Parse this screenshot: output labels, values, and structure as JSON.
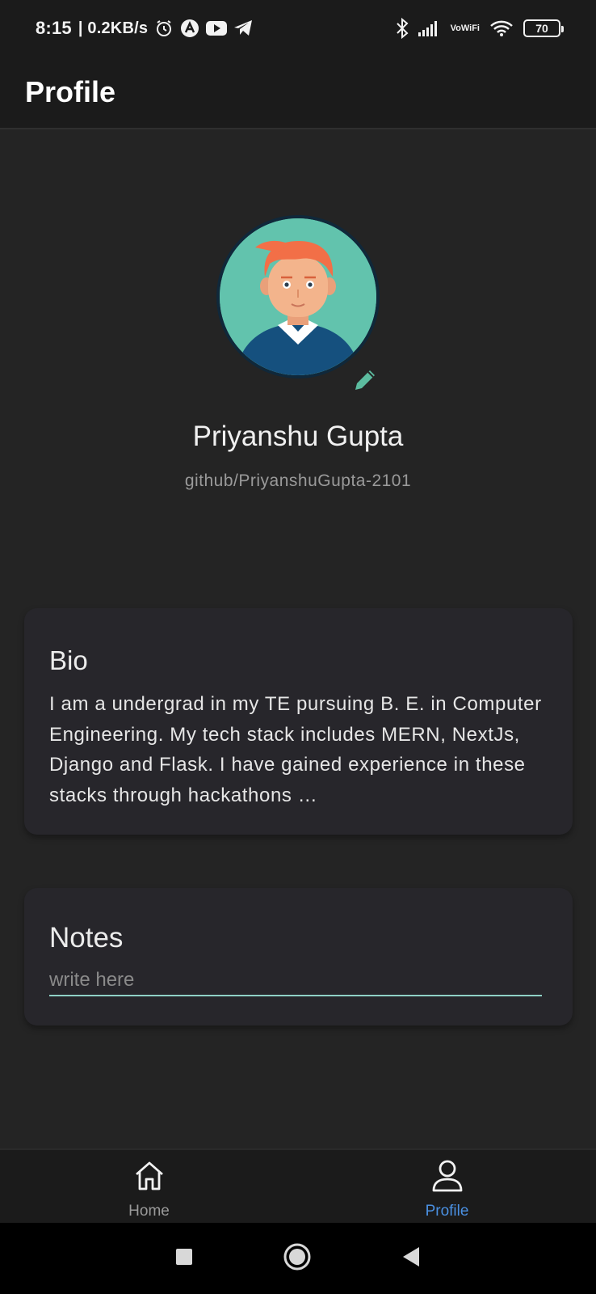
{
  "status_bar": {
    "time": "8:15",
    "net_speed": "| 0.2KB/s",
    "vowifi_top": "Vo",
    "vowifi_bottom": "WiFi",
    "battery_level": "70"
  },
  "app_bar": {
    "title": "Profile"
  },
  "profile": {
    "name": "Priyanshu Gupta",
    "github": "github/PriyanshuGupta-2101"
  },
  "bio": {
    "title": "Bio",
    "text": "I am a undergrad in my TE pursuing B. E. in Computer Engineering. My tech stack includes MERN, NextJs, Django and Flask. I have gained experience in these stacks through hackathons …"
  },
  "notes": {
    "title": "Notes",
    "placeholder": "write here",
    "value": ""
  },
  "bottom_nav": {
    "items": [
      {
        "label": "Home",
        "icon": "home-icon",
        "active": false
      },
      {
        "label": "Profile",
        "icon": "person-icon",
        "active": true
      }
    ]
  },
  "colors": {
    "background": "#242424",
    "bar": "#1b1b1b",
    "card": "#27262b",
    "accent": "#4a90e2",
    "teal": "#62c3ad"
  }
}
